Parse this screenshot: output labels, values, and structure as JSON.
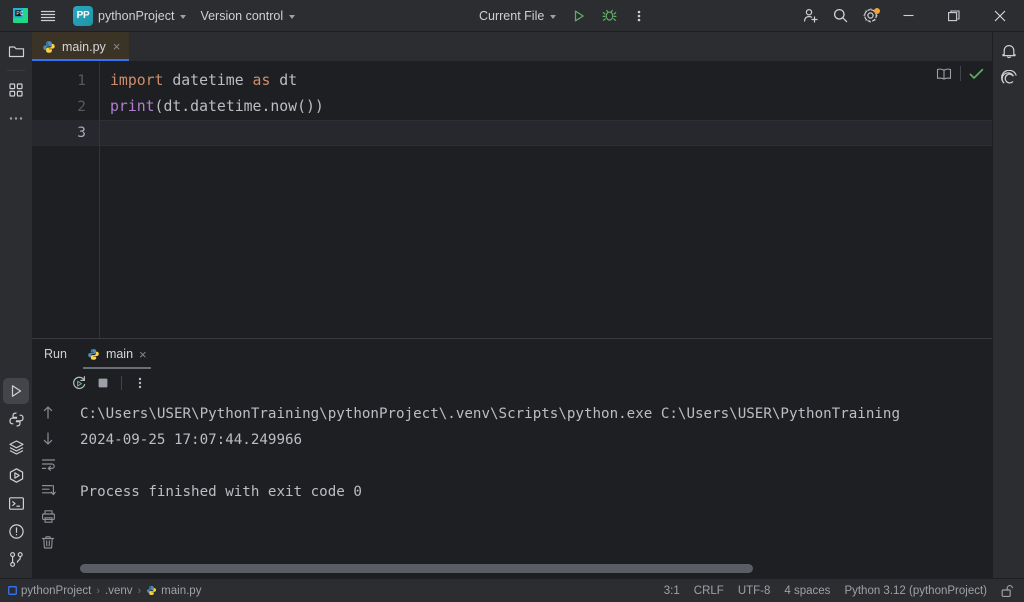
{
  "toolbar": {
    "product_icon": "pycharm-logo-icon",
    "menu_icon": "hamburger-menu-icon",
    "project_badge": "PP",
    "project_name": "pythonProject",
    "version_control": "Version control",
    "run_config": "Current File",
    "run_icon": "run-play-icon",
    "debug_icon": "debug-bug-icon",
    "more_icon": "more-vertical-icon",
    "share_icon": "add-user-icon",
    "search_icon": "search-icon",
    "settings_icon": "settings-gear-icon",
    "minimize_icon": "window-minimize-icon",
    "maximize_icon": "window-maximize-icon",
    "close_icon": "window-close-icon"
  },
  "left_stripe": {
    "items": [
      {
        "name": "project-tool-window",
        "icon": "folder-icon"
      },
      {
        "name": "structure-tool-window",
        "icon": "four-squares-icon"
      },
      {
        "name": "more-tool-windows",
        "icon": "ellipsis-icon"
      }
    ],
    "bottom_items": [
      {
        "name": "run-tool-window",
        "icon": "run-play-icon",
        "active": true
      },
      {
        "name": "python-console-tool-window",
        "icon": "python-icon"
      },
      {
        "name": "services-tool-window",
        "icon": "layers-icon"
      },
      {
        "name": "debug-tool-window",
        "icon": "play-circle-icon"
      },
      {
        "name": "terminal-tool-window",
        "icon": "terminal-icon"
      },
      {
        "name": "problems-tool-window",
        "icon": "warning-circle-icon"
      },
      {
        "name": "version-control-tool-window",
        "icon": "branch-icon"
      }
    ]
  },
  "right_stripe": {
    "items": [
      {
        "name": "notifications",
        "icon": "bell-icon"
      },
      {
        "name": "ai-assistant",
        "icon": "spiral-icon"
      }
    ]
  },
  "editor": {
    "tab": {
      "label": "main.py",
      "icon": "python-file-icon",
      "close": "×"
    },
    "reader_mode_icon": "book-icon",
    "inspections_icon": "checkmark-icon",
    "lines": [
      {
        "number": "1",
        "tokens": [
          {
            "text": "import",
            "cls": "kw"
          },
          {
            "text": " datetime ",
            "cls": "plain"
          },
          {
            "text": "as",
            "cls": "kw"
          },
          {
            "text": " dt",
            "cls": "plain"
          }
        ]
      },
      {
        "number": "2",
        "tokens": [
          {
            "text": "print",
            "cls": "fn"
          },
          {
            "text": "(dt.datetime.now())",
            "cls": "plain"
          }
        ]
      },
      {
        "number": "3",
        "tokens": [
          {
            "text": "",
            "cls": "plain"
          }
        ],
        "current": true
      }
    ]
  },
  "run_panel": {
    "title": "Run",
    "tab": {
      "label": "main",
      "icon": "python-file-icon",
      "close": "×"
    },
    "toolbar": [
      {
        "name": "rerun-button",
        "icon": "rerun-icon"
      },
      {
        "name": "stop-button",
        "icon": "stop-square-icon"
      },
      {
        "name": "run-more-button",
        "icon": "more-vertical-icon"
      }
    ],
    "gutter": [
      {
        "name": "previous-occurrence-button",
        "icon": "arrow-up-icon"
      },
      {
        "name": "next-occurrence-button",
        "icon": "arrow-down-icon"
      },
      {
        "name": "soft-wrap-button",
        "icon": "soft-wrap-icon"
      },
      {
        "name": "scroll-to-end-button",
        "icon": "scroll-to-end-icon"
      },
      {
        "name": "print-button",
        "icon": "printer-icon"
      },
      {
        "name": "clear-all-button",
        "icon": "trash-icon"
      }
    ],
    "output": [
      "C:\\Users\\USER\\PythonTraining\\pythonProject\\.venv\\Scripts\\python.exe C:\\Users\\USER\\PythonTraining",
      "2024-09-25 17:07:44.249966",
      "",
      "Process finished with exit code 0"
    ]
  },
  "status_bar": {
    "breadcrumbs": [
      "pythonProject",
      ".venv",
      "main.py"
    ],
    "separator": "›",
    "caret_position": "3:1",
    "line_separator": "CRLF",
    "encoding": "UTF-8",
    "indent": "4 spaces",
    "interpreter": "Python 3.12 (pythonProject)",
    "lock_icon": "unlocked-padlock-icon"
  },
  "colors": {
    "accent_blue": "#3574f0",
    "tab_active_bg": "#3b3426",
    "keyword_orange": "#cf8e6d",
    "function_purple": "#b07fd0",
    "run_green": "#59a869",
    "badge_orange": "#f2a33c"
  }
}
